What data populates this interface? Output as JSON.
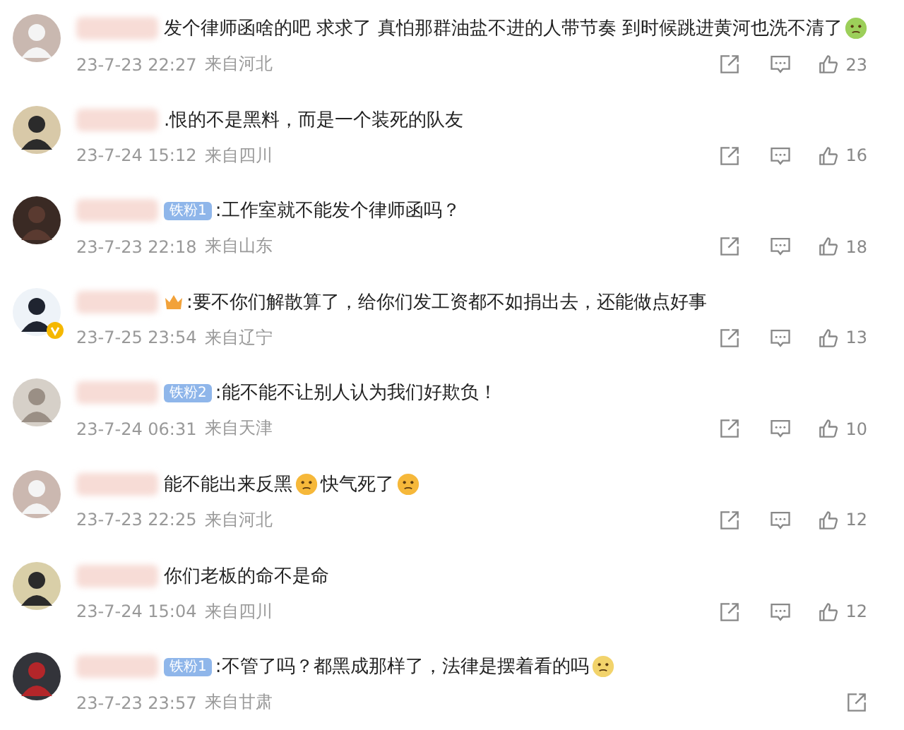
{
  "comments": [
    {
      "medal": false,
      "verified": false,
      "parts": [
        {
          "kind": "text",
          "text": "发个律师函啥的吧 求求了 真怕那群油盐不进的人带节奏 到时候跳进黄河也洗不清了"
        },
        {
          "kind": "emoji",
          "color": "#9ccf5a"
        }
      ],
      "date": "23-7-23 22:27",
      "location": "来自河北",
      "likes": "23"
    },
    {
      "medal": false,
      "verified": false,
      "parts": [
        {
          "kind": "text",
          "text": ".恨的不是黑料，而是一个装死的队友"
        }
      ],
      "date": "23-7-24 15:12",
      "location": "来自四川",
      "likes": "16"
    },
    {
      "badge": "铁粉1",
      "medal": false,
      "verified": false,
      "parts": [
        {
          "kind": "text",
          "text": ":工作室就不能发个律师函吗？"
        }
      ],
      "date": "23-7-23 22:18",
      "location": "来自山东",
      "likes": "18"
    },
    {
      "medal": true,
      "verified": true,
      "parts": [
        {
          "kind": "text",
          "text": ":要不你们解散算了，给你们发工资都不如捐出去，还能做点好事"
        }
      ],
      "date": "23-7-25 23:54",
      "location": "来自辽宁",
      "likes": "13"
    },
    {
      "badge": "铁粉2",
      "medal": false,
      "verified": false,
      "parts": [
        {
          "kind": "text",
          "text": ":能不能不让别人认为我们好欺负！"
        }
      ],
      "date": "23-7-24 06:31",
      "location": "来自天津",
      "likes": "10"
    },
    {
      "medal": false,
      "verified": false,
      "parts": [
        {
          "kind": "text",
          "text": "能不能出来反黑"
        },
        {
          "kind": "emoji",
          "color": "#f6b83a"
        },
        {
          "kind": "text",
          "text": "快气死了"
        },
        {
          "kind": "emoji",
          "color": "#f6b83a"
        }
      ],
      "date": "23-7-23 22:25",
      "location": "来自河北",
      "likes": "12"
    },
    {
      "medal": false,
      "verified": false,
      "parts": [
        {
          "kind": "text",
          "text": "你们老板的命不是命"
        }
      ],
      "date": "23-7-24 15:04",
      "location": "来自四川",
      "likes": "12"
    },
    {
      "badge": "铁粉1",
      "medal": false,
      "verified": false,
      "parts": [
        {
          "kind": "text",
          "text": ":不管了吗？都黑成那样了，法律是摆着看的吗"
        },
        {
          "kind": "emoji",
          "color": "#f2d36b"
        }
      ],
      "date": "23-7-23 23:57",
      "location": "来自甘肃"
    }
  ]
}
